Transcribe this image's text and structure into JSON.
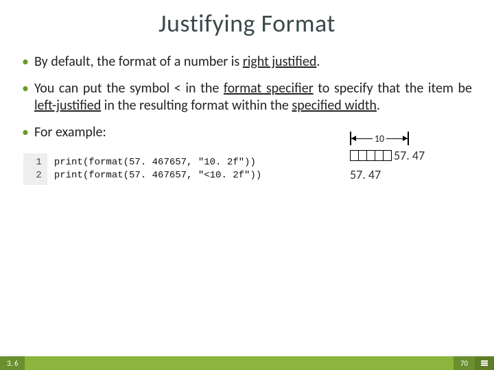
{
  "title": "Justifying Format",
  "bullets": {
    "b1_pre": "By default, the format of a number is ",
    "b1_u": "right justified",
    "b1_post": ".",
    "b2_pre": "You can put the symbol < in the ",
    "b2_u1": "format specifier",
    "b2_mid": " to specify that the item be ",
    "b2_u2": "left-justified",
    "b2_mid2": " in the resulting format within the ",
    "b2_u3": "specified width",
    "b2_post": ".",
    "b3": "For example:"
  },
  "code": {
    "gutter": " 1\n 2",
    "lines": "print(format(57. 467657, \"10. 2f\"))\nprint(format(57. 467657, \"<10. 2f\"))"
  },
  "diagram": {
    "width_label": "10",
    "value_right": "57. 47",
    "value_left": "57. 47"
  },
  "footer": {
    "section": "3. 6",
    "page": "70"
  }
}
